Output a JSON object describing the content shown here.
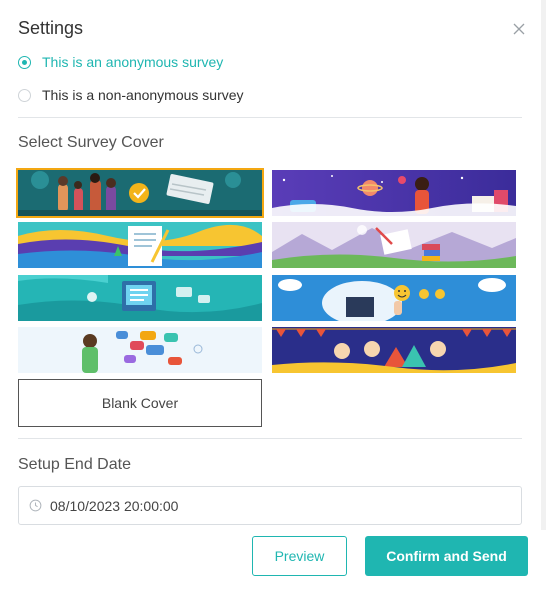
{
  "dialog": {
    "title": "Settings",
    "close_icon": "close-icon"
  },
  "survey_type": {
    "options": [
      {
        "label": "This is an anonymous survey",
        "checked": true
      },
      {
        "label": "This is a non-anonymous survey",
        "checked": false
      }
    ]
  },
  "cover": {
    "section_label": "Select Survey Cover",
    "blank_label": "Blank Cover",
    "selected_index": 0
  },
  "end_date": {
    "section_label": "Setup End Date",
    "value": "08/10/2023 20:00:00",
    "icon": "clock-icon"
  },
  "actions": {
    "preview_label": "Preview",
    "confirm_label": "Confirm and Send"
  },
  "colors": {
    "accent": "#1fb6b1",
    "selected_outline": "#f3a712"
  }
}
